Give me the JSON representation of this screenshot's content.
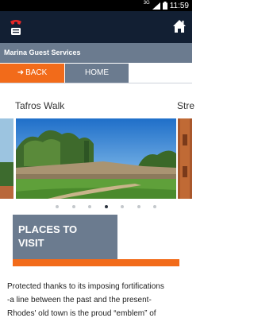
{
  "status_bar": {
    "network_label": "3G",
    "time": "11:59"
  },
  "header": {
    "left_icon": "phone-icon",
    "right_icon": "home-icon"
  },
  "subheader": {
    "title": "Marina Guest Services"
  },
  "nav": {
    "back_label": "BACK",
    "home_label": "HOME"
  },
  "carousel": {
    "current_title": "Tafros Walk",
    "next_title": "Stre",
    "page_count": 7,
    "active_index": 3
  },
  "section": {
    "title_line1": "PLACES TO",
    "title_line2": "VISIT"
  },
  "body": {
    "line1": "Protected thanks to its imposing fortifications",
    "line2": "-a line between the past and the present-",
    "line3": "Rhodes' old town is the proud “emblem” of"
  },
  "colors": {
    "accent": "#f26b1a",
    "header_bg": "#121f33",
    "slate": "#6b7b8f"
  }
}
